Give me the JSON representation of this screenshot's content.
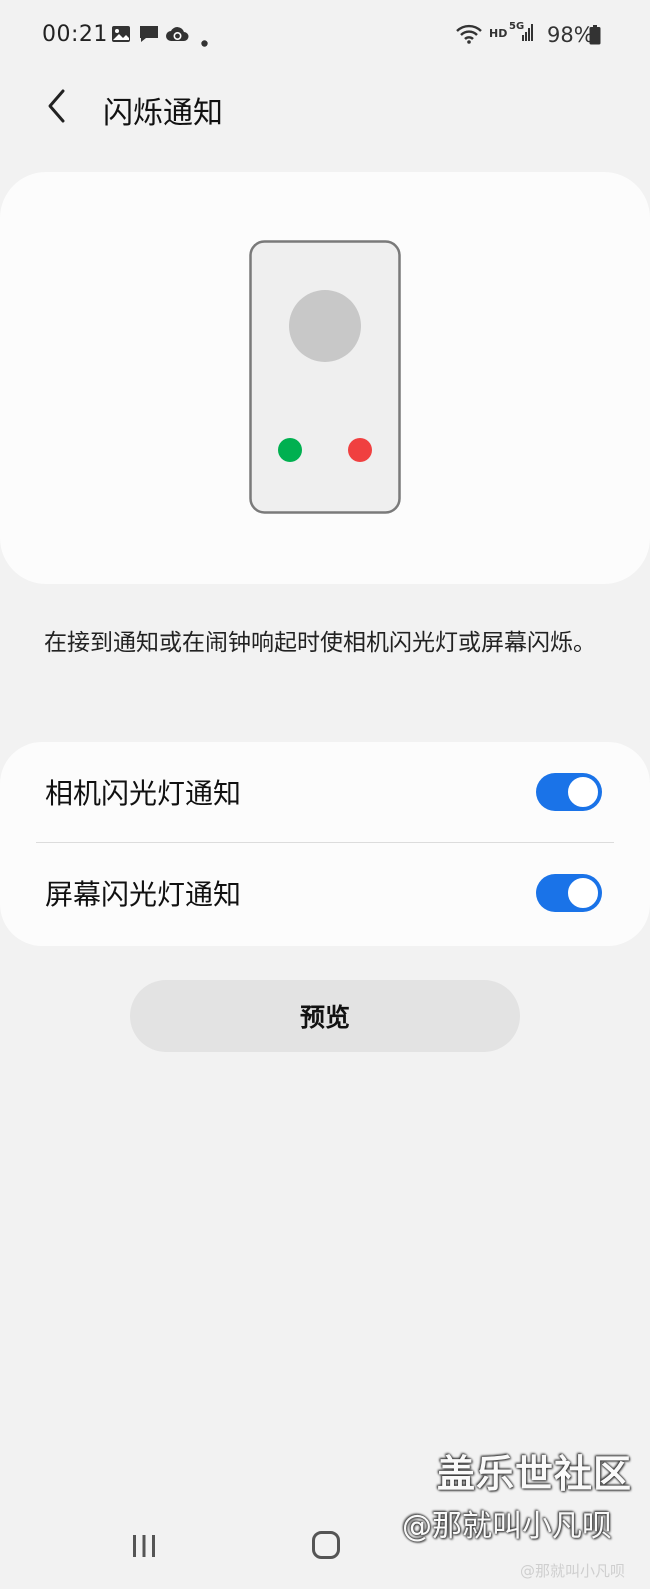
{
  "status_bar": {
    "time": "00:21",
    "left_icons": [
      "gallery-icon",
      "message-icon",
      "cloud-sync-icon",
      "dot-icon"
    ],
    "right_icons": [
      "wifi-icon",
      "hd-volte-icon",
      "5g-signal-icon",
      "battery-icon"
    ],
    "hd_label": "HD",
    "network_label": "5G",
    "battery_percent": "98%"
  },
  "header": {
    "back_icon": "chevron-left-icon",
    "title": "闪烁通知"
  },
  "illustration": {
    "description": "",
    "colors": {
      "phone_fill": "#efefef",
      "phone_border": "#7a7a7a",
      "avatar": "#c8c8c8",
      "accept_dot": "#00b050",
      "decline_dot": "#f04040"
    }
  },
  "description": "在接到通知或在闹钟响起时使相机闪光灯或屏幕闪烁。",
  "settings": {
    "items": [
      {
        "label": "相机闪光灯通知",
        "enabled": true
      },
      {
        "label": "屏幕闪光灯通知",
        "enabled": true
      }
    ],
    "toggle_color": "#1a73e8"
  },
  "preview_button": {
    "label": "预览"
  },
  "nav_bar": {
    "icons": [
      "recents-icon",
      "home-icon"
    ]
  },
  "watermark": {
    "logo": "盖乐世社区",
    "user": "@那就叫小凡呗",
    "small": "@那就叫小凡呗"
  }
}
